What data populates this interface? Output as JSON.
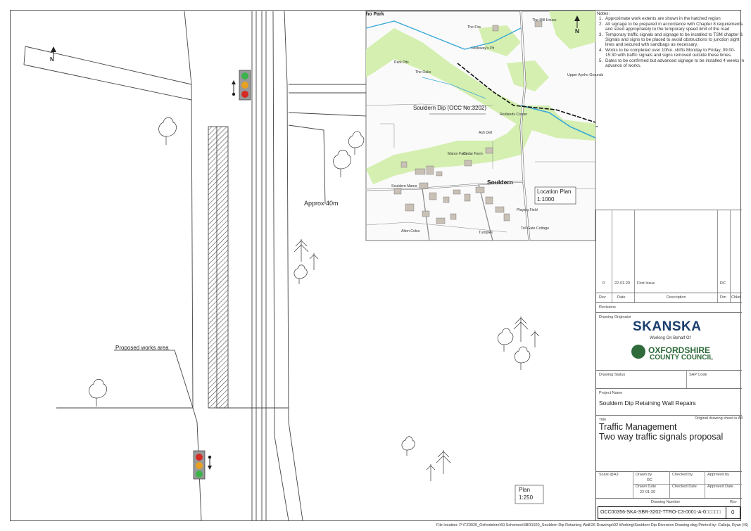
{
  "drawing": {
    "approx_label": "Approx 40m",
    "works_label": "Proposed works area",
    "plan_label": "Plan",
    "plan_scale": "1:250",
    "north": "N"
  },
  "location_map": {
    "site_label": "Souldern Dip (OCC No.3202)",
    "village_label": "Souldern",
    "plan_label": "Location Plan",
    "plan_scale": "1:1000",
    "north": "N",
    "places": [
      "The Firs",
      "Holloway's Pit",
      "Park Pits",
      "The Oaks",
      "The Mill House",
      "Upper Aynho Grounds",
      "Redlands Corner",
      "Ash Dell",
      "Manor Farm",
      "Cedar Farm",
      "Souldern Manor",
      "Playing Field",
      "Toll Gate Cottage",
      "Turnpike",
      "Alton Coles"
    ],
    "top_label": "ho Park"
  },
  "notes": {
    "heading": "Notes:",
    "items": [
      "Approximate work extents are shown in the hatched region",
      "All signage  to be prepared in accordance with Chapter 8 requirements and sized appropriately to the temporary speed limit of the road",
      "Temporary traffic signals and signage to be installed to TSM chapter 8. Signals and signs to be placed to avoid obstructions to junction sight lines and secured with sandbags as necessary.",
      "Works to be completed over 10No. shifts Monday to Friday, 09:00-15:30 with traffic signals and signs removed outside these times.",
      "Dates to be confirmed but advanced signage to be installed 4 weeks in advance of works."
    ]
  },
  "title_block": {
    "revision": {
      "rev": "0",
      "date": "22-01-20",
      "description": "First Issue",
      "by": "RC"
    },
    "rev_headers": [
      "Rev",
      "Date",
      "Description",
      "Drn",
      "Chkd"
    ],
    "revisions_label": "Revisions",
    "originator_label": "Drawing Originator",
    "company": "SKANSKA",
    "on_behalf": "Working On Behalf Of",
    "council_line1": "OXFORDSHIRE",
    "council_line2": "COUNTY COUNCIL",
    "status_label": "Drawing Status",
    "sap_label": "SAP Code",
    "project_label": "Project Name",
    "project_name": "Souldern Dip Retaining Wall Repairs",
    "title_label": "Title",
    "original_sheet": "Original drawing sheet is A3",
    "title_line1": "Traffic Management",
    "title_line2": "Two way traffic signals proposal",
    "scale_label": "Scale @A3",
    "drawn_by_label": "Drawn by",
    "drawn_by": "RC",
    "checked_by_label": "Checked by",
    "approved_by_label": "Approved by",
    "drawn_date_label": "Drawn Date",
    "drawn_date": "22-01-20",
    "checked_date_label": "Checked Date",
    "approved_date_label": "Approved Date",
    "drawing_number_label": "Drawing Number",
    "rev_label": "Rev",
    "drawing_number": "OCC00356-SKA-SBR-3202-TTRO-C3-0001-A-0□□□□□",
    "drawing_rev": "0"
  },
  "footer": "File location: P:\\TZ0020_Oxfordshire\\60.Schemes\\SBR1920_Souldern Dip Retaining Wall\\26 Drawings\\02 Working\\Souldern Dip Diversion Drawing.dwg  Printed by: Calleja, Ryan (IS)"
}
